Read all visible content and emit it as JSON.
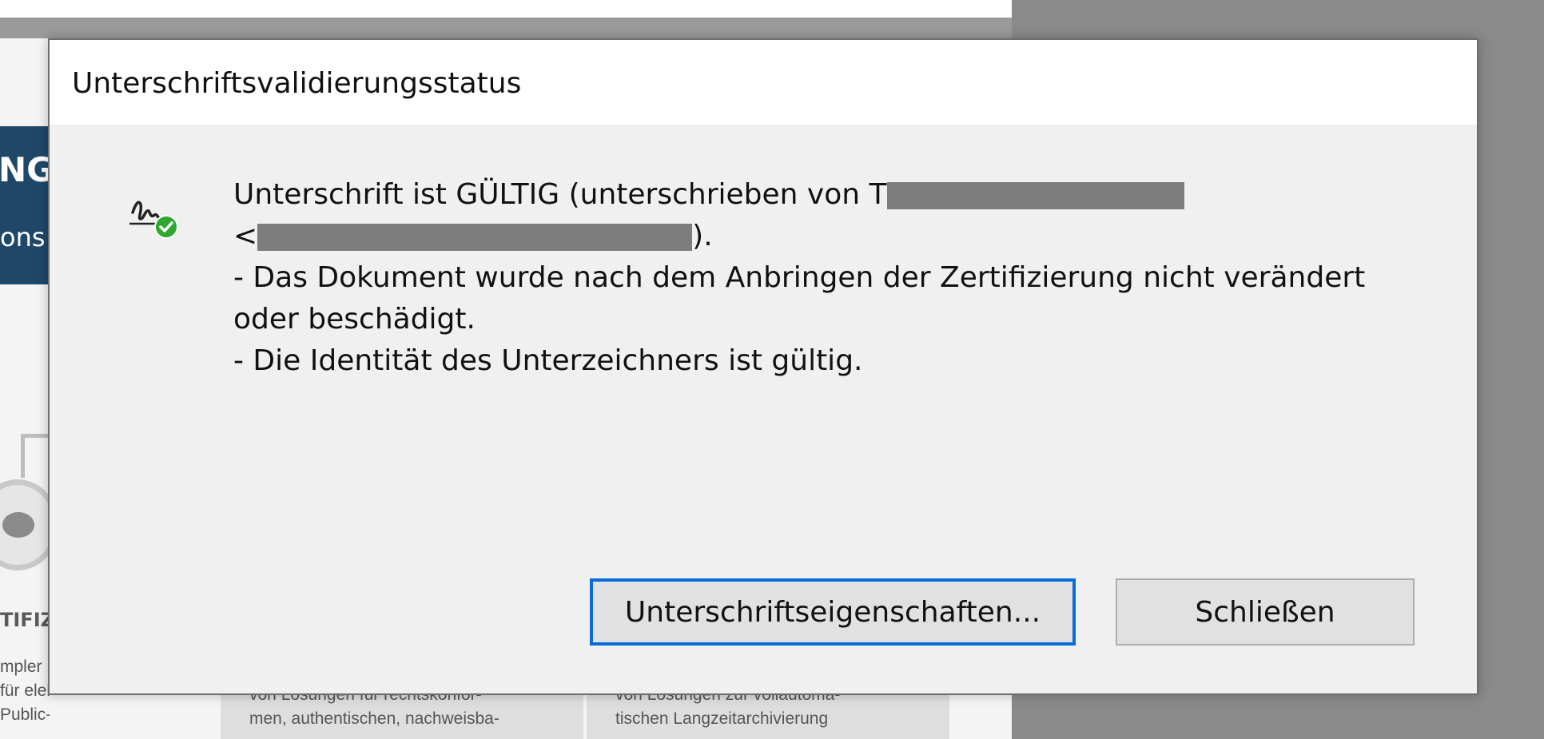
{
  "dialog": {
    "title": "Unterschriftsvalidierungsstatus",
    "message": {
      "line1_prefix": "Unterschrift ist GÜLTIG (unterschrieben von T",
      "line2_prefix": "<",
      "line2_suffix": ").",
      "line3": "- Das Dokument wurde nach dem Anbringen der Zertifizierung nicht verändert",
      "line4": "oder beschädigt.",
      "line5": "- Die Identität des Unterzeichners ist gültig."
    },
    "buttons": {
      "properties_label": "Unterschriftseigenschaften...",
      "close_label": "Schließen"
    },
    "icons": {
      "signature": "signature-valid-icon",
      "status": "check-circle-icon"
    }
  },
  "background": {
    "banner_line1": "NGS",
    "banner_line2": "ons",
    "section_label": "TIFIZ",
    "left_lines": [
      "mpler",
      "für elektronische",
      "Public-Key-Infra-"
    ],
    "col2_lines": [
      "von Lösungen für rechtskonfor-",
      "men, authentischen, nachweisba-"
    ],
    "col3_lines": [
      "von Lösungen zur vollautoma-",
      "tischen Langzeitarchivierung"
    ]
  },
  "colors": {
    "dialog_bg": "#f0f0f0",
    "primary_border": "#0a6cd8",
    "banner": "#1f4868",
    "valid_green": "#2ea82e"
  }
}
